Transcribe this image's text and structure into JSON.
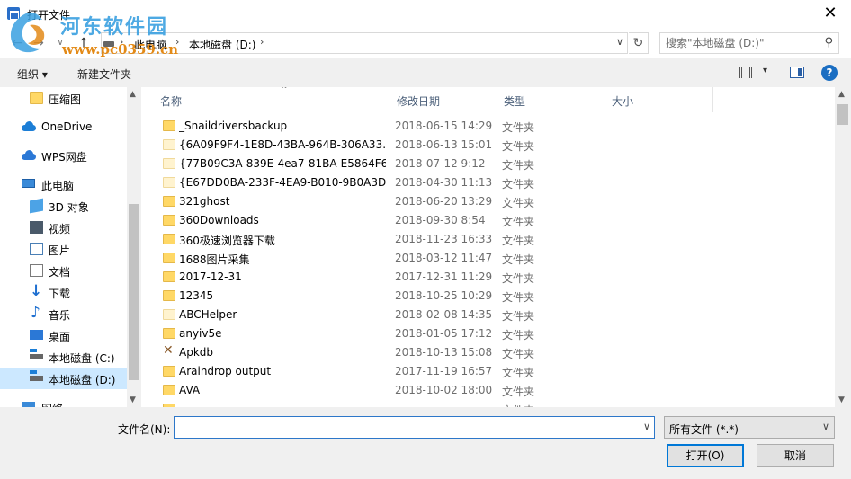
{
  "titlebar": {
    "title": "打开文件",
    "close_glyph": "✕"
  },
  "watermark": {
    "text": "河东软件园",
    "url": "www.pc0359.cn"
  },
  "address": {
    "back_glyph": "←",
    "forward_glyph": "→",
    "down_glyph": "∨",
    "up_glyph": "↑",
    "breadcrumbs": [
      "此电脑",
      "本地磁盘 (D:)"
    ],
    "separator": "›",
    "dropdown_glyph": "∨",
    "refresh_glyph": "↻"
  },
  "search": {
    "placeholder": "搜索\"本地磁盘 (D:)\"",
    "icon_glyph": "⚲"
  },
  "toolbar": {
    "organize": "组织 ▾",
    "new_folder": "新建文件夹",
    "views_arrow": "▾",
    "help": "?"
  },
  "nav": {
    "items": [
      {
        "label": "压缩图",
        "icon": "folder-icon"
      },
      {
        "label": "OneDrive",
        "icon": "onedrive-icon"
      },
      {
        "label": "WPS网盘",
        "icon": "wps-cloud-icon"
      },
      {
        "label": "此电脑",
        "icon": "computer-icon"
      },
      {
        "label": "3D 对象",
        "icon": "3d-objects-icon"
      },
      {
        "label": "视频",
        "icon": "videos-icon"
      },
      {
        "label": "图片",
        "icon": "pictures-icon"
      },
      {
        "label": "文档",
        "icon": "documents-icon"
      },
      {
        "label": "下载",
        "icon": "downloads-icon"
      },
      {
        "label": "音乐",
        "icon": "music-icon"
      },
      {
        "label": "桌面",
        "icon": "desktop-icon"
      },
      {
        "label": "本地磁盘 (C:)",
        "icon": "drive-c-icon"
      },
      {
        "label": "本地磁盘 (D:)",
        "icon": "drive-d-icon",
        "selected": true
      },
      {
        "label": "网络",
        "icon": "network-icon"
      }
    ],
    "scroll_up": "▲",
    "scroll_down": "▼"
  },
  "columns": {
    "name": "名称",
    "date": "修改日期",
    "type": "类型",
    "size": "大小",
    "sort_glyph": "^"
  },
  "files": [
    {
      "name": "_Snaildriversbackup",
      "date": "2018-06-15 14:29",
      "type": "文件夹",
      "icon": "folder-icon"
    },
    {
      "name": "{6A09F9F4-1E8D-43BA-964B-306A33...",
      "date": "2018-06-13 15:01",
      "type": "文件夹",
      "icon": "folder-icon-light"
    },
    {
      "name": "{77B09C3A-839E-4ea7-81BA-E5864F6...",
      "date": "2018-07-12 9:12",
      "type": "文件夹",
      "icon": "folder-icon-light"
    },
    {
      "name": "{E67DD0BA-233F-4EA9-B010-9B0A3D...",
      "date": "2018-04-30 11:13",
      "type": "文件夹",
      "icon": "folder-icon-light"
    },
    {
      "name": "321ghost",
      "date": "2018-06-20 13:29",
      "type": "文件夹",
      "icon": "folder-icon"
    },
    {
      "name": "360Downloads",
      "date": "2018-09-30 8:54",
      "type": "文件夹",
      "icon": "folder-icon"
    },
    {
      "name": "360极速浏览器下载",
      "date": "2018-11-23 16:33",
      "type": "文件夹",
      "icon": "folder-icon"
    },
    {
      "name": "1688图片采集",
      "date": "2018-03-12 11:47",
      "type": "文件夹",
      "icon": "folder-icon"
    },
    {
      "name": "2017-12-31",
      "date": "2017-12-31 11:29",
      "type": "文件夹",
      "icon": "folder-icon"
    },
    {
      "name": "12345",
      "date": "2018-10-25 10:29",
      "type": "文件夹",
      "icon": "folder-icon"
    },
    {
      "name": "ABCHelper",
      "date": "2018-02-08 14:35",
      "type": "文件夹",
      "icon": "folder-icon-light"
    },
    {
      "name": "anyiv5e",
      "date": "2018-01-05 17:12",
      "type": "文件夹",
      "icon": "folder-icon"
    },
    {
      "name": "Apkdb",
      "date": "2018-10-13 15:08",
      "type": "文件夹",
      "icon": "app-folder-icon"
    },
    {
      "name": "Araindrop output",
      "date": "2017-11-19 16:57",
      "type": "文件夹",
      "icon": "folder-icon"
    },
    {
      "name": "AVA",
      "date": "2018-10-02 18:00",
      "type": "文件夹",
      "icon": "folder-icon"
    },
    {
      "name": "",
      "date": "",
      "type": "文件夹",
      "icon": "folder-icon"
    }
  ],
  "filescroll": {
    "up": "▲",
    "down": "▼"
  },
  "bottom": {
    "filename_label": "文件名(N):",
    "filename_value": "",
    "dropdown_glyph": "∨",
    "filter": "所有文件 (*.*)",
    "open": "打开(O)",
    "cancel": "取消"
  }
}
